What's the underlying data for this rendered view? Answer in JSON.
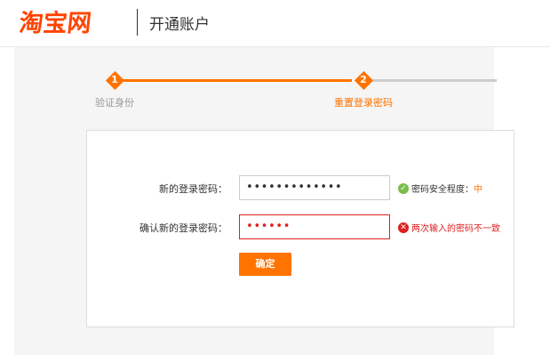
{
  "header": {
    "logo_text": "淘宝网",
    "subtitle": "开通账户",
    "brand_color": "#ff4400"
  },
  "steps": [
    {
      "number": "1",
      "label": "验证身份",
      "state": "done"
    },
    {
      "number": "2",
      "label": "重置登录密码",
      "state": "active"
    }
  ],
  "form": {
    "new_password_label": "新的登录密码：",
    "new_password_value": "•••••••••••••",
    "strength_hint_prefix": "密码安全程度：",
    "strength_value": "中",
    "confirm_password_label": "确认新的登录密码：",
    "confirm_password_value": "••••••",
    "mismatch_hint": "两次输入的密码不一致",
    "submit_label": "确定"
  },
  "colors": {
    "accent": "#ff7300",
    "success": "#7cbc4a",
    "error": "#e02020"
  }
}
